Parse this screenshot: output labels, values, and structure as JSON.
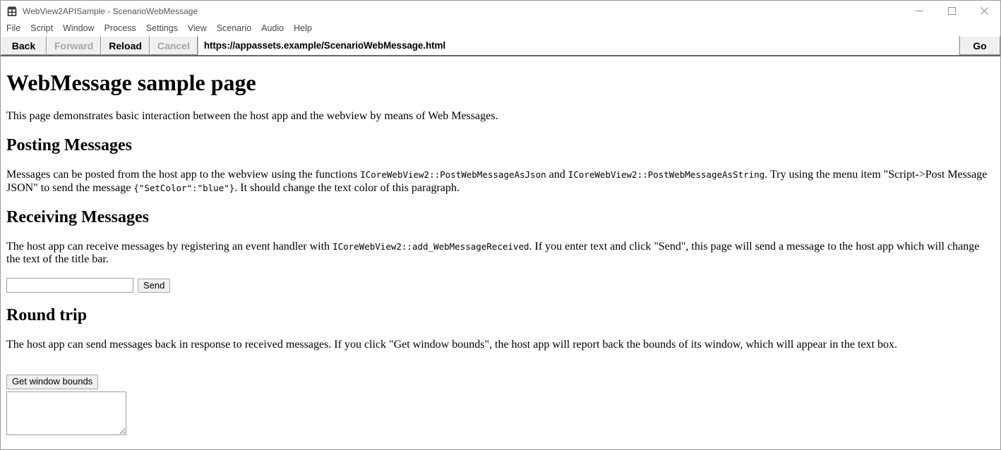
{
  "window": {
    "title": "WebView2APISample - ScenarioWebMessage",
    "app_icon": "window-grid-icon",
    "controls": {
      "minimize": "minimize-icon",
      "maximize": "maximize-icon",
      "close": "close-icon"
    }
  },
  "menubar": {
    "items": [
      {
        "label": "File"
      },
      {
        "label": "Script"
      },
      {
        "label": "Window"
      },
      {
        "label": "Process"
      },
      {
        "label": "Settings"
      },
      {
        "label": "View"
      },
      {
        "label": "Scenario"
      },
      {
        "label": "Audio"
      },
      {
        "label": "Help"
      }
    ]
  },
  "toolbar": {
    "back_label": "Back",
    "forward_label": "Forward",
    "reload_label": "Reload",
    "cancel_label": "Cancel",
    "go_label": "Go",
    "address_value": "https://appassets.example/ScenarioWebMessage.html",
    "address_placeholder": ""
  },
  "page": {
    "h1": "WebMessage sample page",
    "intro": "This page demonstrates basic interaction between the host app and the webview by means of Web Messages.",
    "posting": {
      "heading": "Posting Messages",
      "p1_a": "Messages can be posted from the host app to the webview using the functions ",
      "p1_code1": "ICoreWebView2::PostWebMessageAsJson",
      "p1_b": " and ",
      "p1_code2": "ICoreWebView2::PostWebMessageAsString",
      "p1_c": ". Try using the menu item \"Script->Post Message JSON\" to send the message ",
      "p1_code3": "{\"SetColor\":\"blue\"}",
      "p1_d": ". It should change the text color of this paragraph."
    },
    "receiving": {
      "heading": "Receiving Messages",
      "p1_a": "The host app can receive messages by registering an event handler with ",
      "p1_code1": "ICoreWebView2::add_WebMessageReceived",
      "p1_b": ". If you enter text and click \"Send\", this page will send a message to the host app which will change the text of the title bar.",
      "input_value": "",
      "input_placeholder": "",
      "send_label": "Send"
    },
    "roundtrip": {
      "heading": "Round trip",
      "p1": "The host app can send messages back in response to received messages. If you click \"Get window bounds\", the host app will report back the bounds of its window, which will appear in the text box.",
      "button_label": "Get window bounds",
      "textarea_value": "",
      "textarea_placeholder": ""
    }
  },
  "colors": {
    "toolbar_bg": "#f0f0f0",
    "toolbar_border": "#656565",
    "disabled_text": "#a6a6a6",
    "title_text": "#555555",
    "menu_text": "#474747"
  }
}
